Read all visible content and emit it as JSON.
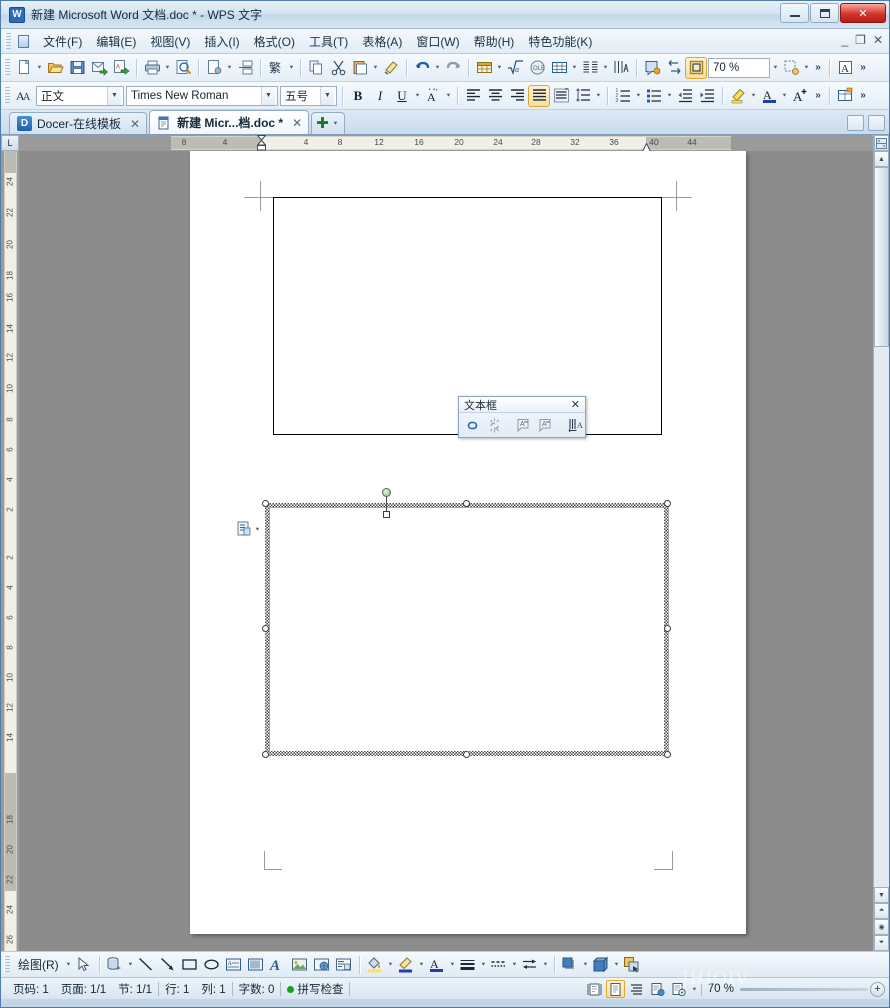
{
  "window": {
    "title": "新建 Microsoft Word 文档.doc * - WPS 文字",
    "logo_letter": "W",
    "minimize_label": "最小化",
    "maximize_label": "最大化",
    "close_label": "关闭"
  },
  "menu": {
    "items": [
      {
        "label": "文件(F)",
        "name": "menu-file"
      },
      {
        "label": "编辑(E)",
        "name": "menu-edit"
      },
      {
        "label": "视图(V)",
        "name": "menu-view"
      },
      {
        "label": "插入(I)",
        "name": "menu-insert"
      },
      {
        "label": "格式(O)",
        "name": "menu-format"
      },
      {
        "label": "工具(T)",
        "name": "menu-tools"
      },
      {
        "label": "表格(A)",
        "name": "menu-table"
      },
      {
        "label": "窗口(W)",
        "name": "menu-window"
      },
      {
        "label": "帮助(H)",
        "name": "menu-help"
      },
      {
        "label": "特色功能(K)",
        "name": "menu-features"
      }
    ],
    "mdi_minimize": "_",
    "mdi_restore": "❐",
    "mdi_close": "✕"
  },
  "standard_toolbar": {
    "zoom_value": "70 %",
    "overflow_label": "»",
    "buttons": [
      {
        "name": "new-document-icon",
        "tip": "新建"
      },
      {
        "name": "open-document-icon",
        "tip": "打开"
      },
      {
        "name": "save-icon",
        "tip": "保存"
      },
      {
        "name": "send-mail-icon",
        "tip": "发送邮件"
      },
      {
        "name": "export-pdf-icon",
        "tip": "输出为PDF"
      },
      {
        "name": "print-icon",
        "tip": "打印"
      },
      {
        "name": "print-preview-icon",
        "tip": "打印预览"
      },
      {
        "name": "page-setup-icon",
        "tip": "页面设置"
      },
      {
        "name": "split-icon",
        "tip": "拆分"
      },
      {
        "name": "traditional-chinese-icon",
        "tip": "简繁转换"
      },
      {
        "name": "copy-icon",
        "tip": "复制"
      },
      {
        "name": "cut-icon",
        "tip": "剪切"
      },
      {
        "name": "paste-icon",
        "tip": "粘贴"
      },
      {
        "name": "format-painter-icon",
        "tip": "格式刷"
      },
      {
        "name": "undo-icon",
        "tip": "撤销"
      },
      {
        "name": "redo-icon",
        "tip": "恢复"
      },
      {
        "name": "insert-table-icon",
        "tip": "插入表格"
      },
      {
        "name": "formula-icon",
        "tip": "公式"
      },
      {
        "name": "insert-object-icon",
        "tip": "插入对象"
      },
      {
        "name": "table-grid-icon",
        "tip": "表格网格"
      },
      {
        "name": "columns-icon",
        "tip": "分栏"
      },
      {
        "name": "chart-icon",
        "tip": "图表"
      },
      {
        "name": "comment-icon",
        "tip": "批注"
      },
      {
        "name": "paragraph-marks-icon",
        "tip": "显示段落标记"
      },
      {
        "name": "show-all-icon",
        "tip": "显示/隐藏"
      },
      {
        "name": "select-object-icon",
        "tip": "选择对象"
      },
      {
        "name": "text-style-icon",
        "tip": "文字样式"
      }
    ]
  },
  "format_toolbar": {
    "style_value": "正文",
    "font_value": "Times New Roman",
    "size_value": "五号",
    "bold_label": "B",
    "italic_label": "I",
    "underline_label": "U",
    "overflow_label": "»",
    "buttons": [
      {
        "name": "style-picker-icon",
        "tip": "样式"
      },
      {
        "name": "character-border-icon",
        "tip": "字符边框"
      },
      {
        "name": "align-left-icon",
        "tip": "左对齐"
      },
      {
        "name": "align-center-icon",
        "tip": "居中"
      },
      {
        "name": "align-right-icon",
        "tip": "右对齐"
      },
      {
        "name": "align-justify-icon",
        "tip": "两端对齐"
      },
      {
        "name": "distribute-icon",
        "tip": "分散对齐"
      },
      {
        "name": "line-spacing-icon",
        "tip": "行距"
      },
      {
        "name": "numbered-list-icon",
        "tip": "编号"
      },
      {
        "name": "bulleted-list-icon",
        "tip": "项目符号"
      },
      {
        "name": "decrease-indent-icon",
        "tip": "减少缩进量"
      },
      {
        "name": "increase-indent-icon",
        "tip": "增加缩进量"
      },
      {
        "name": "highlight-icon",
        "tip": "突出显示"
      },
      {
        "name": "font-color-icon",
        "tip": "字体颜色"
      },
      {
        "name": "grow-font-icon",
        "tip": "增大字号"
      },
      {
        "name": "borders-icon",
        "tip": "边框"
      }
    ]
  },
  "tabs": {
    "items": [
      {
        "label": "Docer-在线模板",
        "active": false,
        "icon": "docer-icon",
        "badge": "D"
      },
      {
        "label": "新建 Micr...档.doc *",
        "active": true,
        "icon": "word-document-icon"
      }
    ],
    "close_glyph": "✕",
    "new_tab_glyph": "✚",
    "right_buttons": [
      {
        "name": "tab-list-button"
      },
      {
        "name": "tab-layout-button"
      }
    ]
  },
  "rulers": {
    "corner_label": "L",
    "horizontal_ticks": [
      "8",
      "4",
      "4",
      "8",
      "12",
      "16",
      "20",
      "24",
      "28",
      "32",
      "36",
      "40",
      "44"
    ],
    "vertical_ticks_top": [
      "24",
      "22",
      "20",
      "18",
      "16",
      "14",
      "12",
      "10",
      "8",
      "6",
      "4",
      "2"
    ],
    "vertical_ticks_bottom": [
      "2",
      "4",
      "6",
      "8",
      "10",
      "12",
      "14",
      "18",
      "20",
      "22",
      "24",
      "26"
    ]
  },
  "document": {
    "page_label": "文档页面",
    "plain_textbox_label": "未选中文本框",
    "selected_textbox_label": "已选中文本框",
    "layout_options_label": "布局选项"
  },
  "floating_toolbar": {
    "title": "文本框",
    "close_glyph": "✕",
    "buttons": [
      {
        "name": "create-textbox-link-icon",
        "tip": "创建文本框链接"
      },
      {
        "name": "break-textbox-link-icon",
        "tip": "断开向前链接"
      },
      {
        "name": "previous-textbox-icon",
        "tip": "前一文本框"
      },
      {
        "name": "next-textbox-icon",
        "tip": "下一文本框"
      },
      {
        "name": "text-direction-icon",
        "tip": "更改文字方向"
      }
    ]
  },
  "drawing_toolbar": {
    "menu_label": "绘图(R)",
    "buttons": [
      {
        "name": "select-arrow-icon",
        "tip": "选择对象"
      },
      {
        "name": "autoshapes-icon",
        "tip": "自选图形"
      },
      {
        "name": "line-icon",
        "tip": "直线"
      },
      {
        "name": "arrow-icon",
        "tip": "箭头"
      },
      {
        "name": "rectangle-icon",
        "tip": "矩形"
      },
      {
        "name": "oval-icon",
        "tip": "椭圆"
      },
      {
        "name": "textbox-icon",
        "tip": "文本框"
      },
      {
        "name": "vertical-textbox-icon",
        "tip": "竖排文本框"
      },
      {
        "name": "wordart-icon",
        "tip": "艺术字"
      },
      {
        "name": "insert-picture-icon",
        "tip": "插入图片"
      },
      {
        "name": "clipart-icon",
        "tip": "剪贴画"
      },
      {
        "name": "diagram-icon",
        "tip": "组织结构图"
      },
      {
        "name": "fill-color-icon",
        "tip": "填充颜色"
      },
      {
        "name": "line-color-icon",
        "tip": "线条颜色"
      },
      {
        "name": "font-color-icon",
        "tip": "字体颜色"
      },
      {
        "name": "line-style-icon",
        "tip": "线型"
      },
      {
        "name": "dash-style-icon",
        "tip": "虚线线型"
      },
      {
        "name": "arrow-style-icon",
        "tip": "箭头样式"
      },
      {
        "name": "shadow-style-icon",
        "tip": "阴影样式"
      },
      {
        "name": "3d-style-icon",
        "tip": "三维效果样式"
      },
      {
        "name": "object-order-icon",
        "tip": "叠放次序"
      }
    ]
  },
  "statusbar": {
    "page_number": "页码: 1",
    "page_count": "页面: 1/1",
    "section": "节: 1/1",
    "line": "行: 1",
    "column": "列: 1",
    "word_count": "字数: 0",
    "spellcheck": "拼写检查",
    "zoom_value": "70 %",
    "zoom_plus": "+",
    "view_buttons": [
      {
        "name": "view-fullscreen-icon",
        "active": false
      },
      {
        "name": "view-page-layout-icon",
        "active": true
      },
      {
        "name": "view-outline-icon",
        "active": false
      },
      {
        "name": "view-web-layout-icon",
        "active": false
      },
      {
        "name": "view-reading-icon",
        "active": false
      }
    ]
  },
  "colors": {
    "accent": "#2a6bbd",
    "title_close": "#d2352b",
    "active_border": "#e0a730",
    "spell_ok": "#19a019",
    "canvas_bg": "#8c8c8c",
    "page_bg": "#ffffff"
  },
  "watermark": "JHIOIV"
}
